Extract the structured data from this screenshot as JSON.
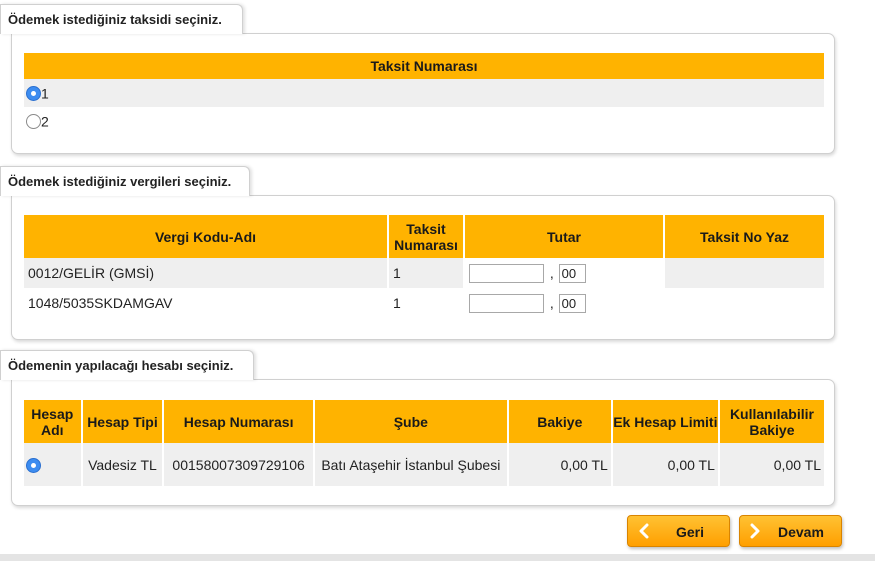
{
  "installment_section": {
    "title": "Ödemek istediğiniz taksidi seçiniz.",
    "column_header": "Taksit Numarası",
    "options": [
      {
        "label": "1",
        "selected": true
      },
      {
        "label": "2",
        "selected": false
      }
    ]
  },
  "tax_section": {
    "title": "Ödemek istediğiniz vergileri seçiniz.",
    "headers": {
      "tax_code": "Vergi Kodu-Adı",
      "installment_no": "Taksit Numarası",
      "amount": "Tutar",
      "installment_write": "Taksit No Yaz"
    },
    "rows": [
      {
        "tax_code": "0012/GELİR (GMSİ)",
        "installment_no": "1",
        "amount_main": "",
        "amount_cents": "00"
      },
      {
        "tax_code": "1048/5035SKDAMGAV",
        "installment_no": "1",
        "amount_main": "",
        "amount_cents": "00"
      }
    ],
    "decimal_separator": ","
  },
  "account_section": {
    "title": "Ödemenin yapılacağı hesabı seçiniz.",
    "headers": {
      "account_name": "Hesap Adı",
      "account_type": "Hesap Tipi",
      "account_number": "Hesap Numarası",
      "branch": "Şube",
      "balance": "Bakiye",
      "extra_limit": "Ek Hesap Limiti",
      "available_balance": "Kullanılabilir Bakiye"
    },
    "rows": [
      {
        "selected": true,
        "account_type": "Vadesiz TL",
        "account_number": "00158007309729106",
        "branch": "Batı Ataşehir İstanbul Şubesi",
        "balance": "0,00 TL",
        "extra_limit": "0,00 TL",
        "available_balance": "0,00 TL"
      }
    ]
  },
  "buttons": {
    "back_label": "Geri",
    "back_icon": "chevron-left-icon",
    "next_label": "Devam",
    "next_icon": "chevron-right-icon"
  },
  "colors": {
    "header_orange": "#ffb300",
    "radio_blue": "#3c8cf0",
    "row_alt": "#efefef"
  }
}
